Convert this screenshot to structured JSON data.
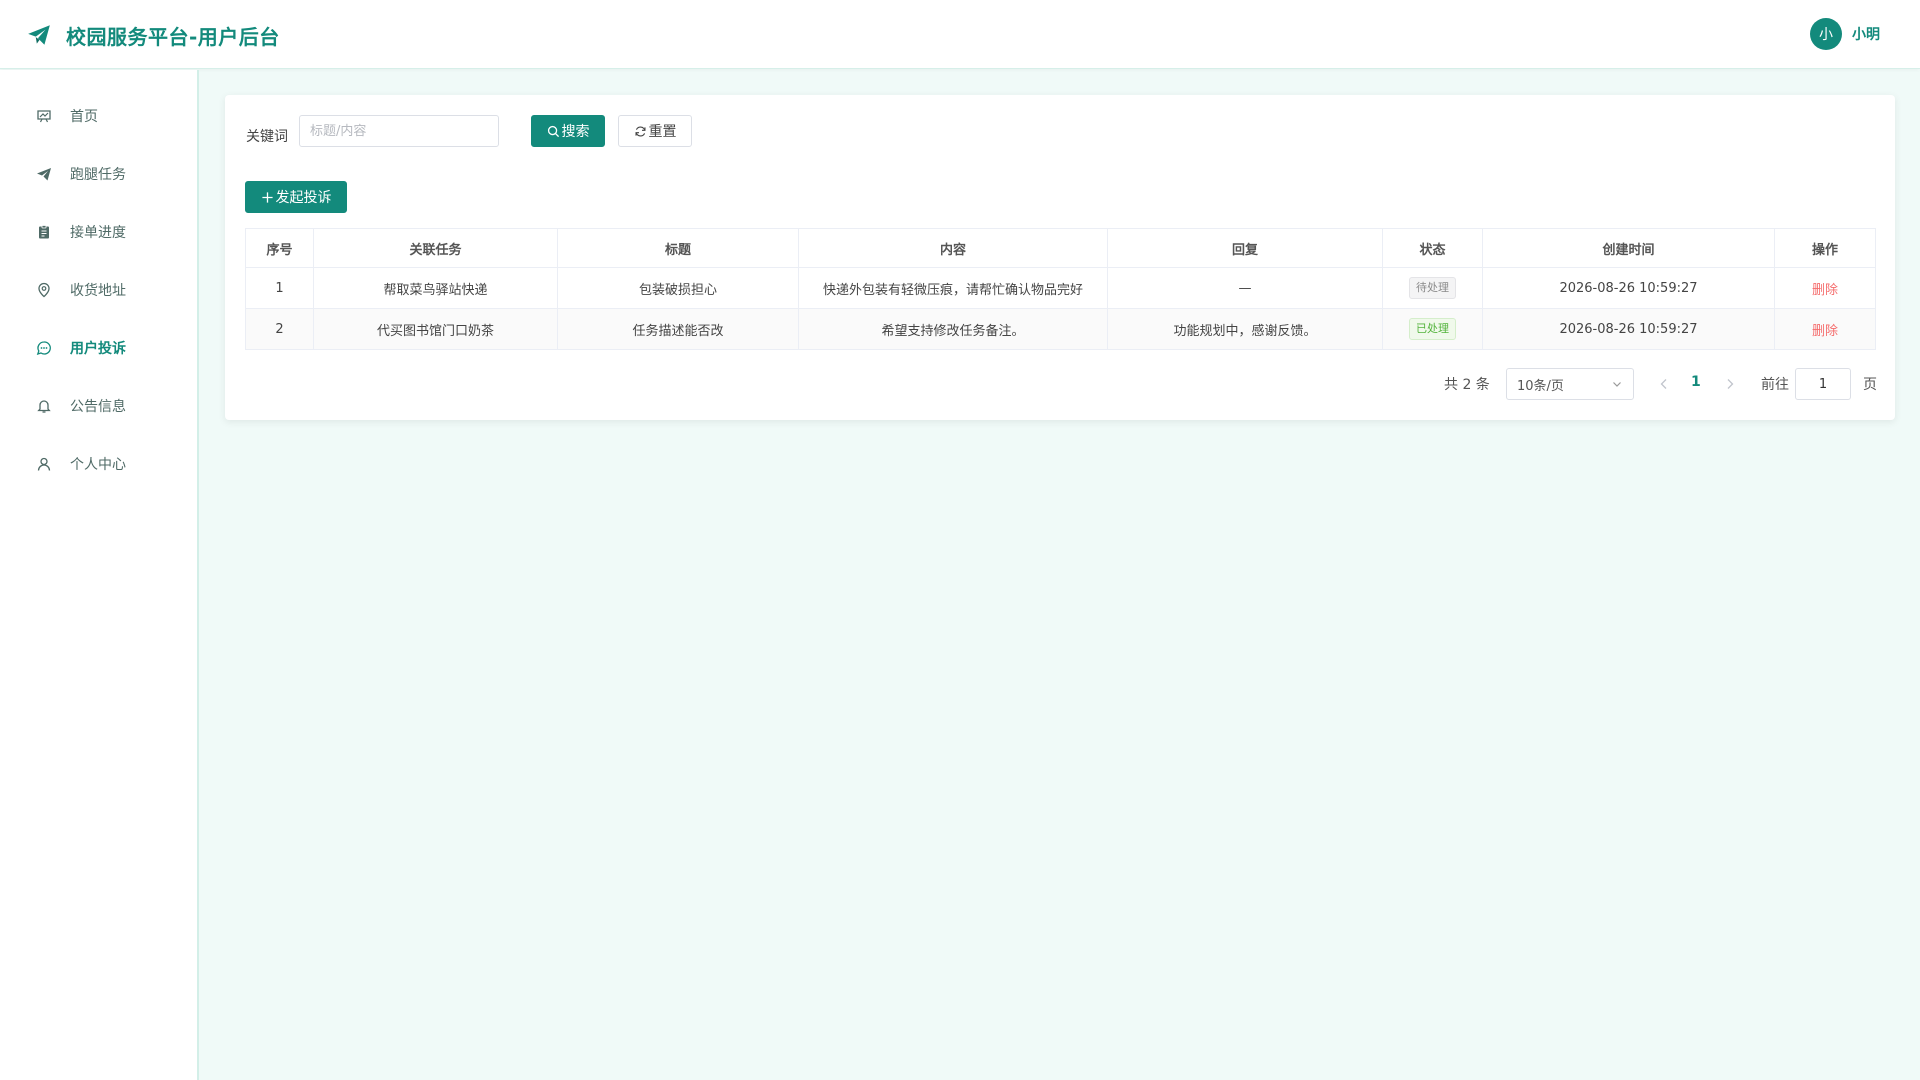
{
  "header": {
    "title": "校园服务平台-用户后台",
    "avatar_text": "小",
    "username": "小明"
  },
  "sidebar": {
    "items": [
      {
        "label": "首页",
        "icon": "presentation-board-icon"
      },
      {
        "label": "跑腿任务",
        "icon": "paper-plane-icon"
      },
      {
        "label": "接单进度",
        "icon": "clipboard-icon"
      },
      {
        "label": "收货地址",
        "icon": "map-pin-icon"
      },
      {
        "label": "用户投诉",
        "icon": "chat-bubble-icon",
        "active": true
      },
      {
        "label": "公告信息",
        "icon": "bell-icon"
      },
      {
        "label": "个人中心",
        "icon": "user-icon"
      }
    ]
  },
  "filter": {
    "keyword_label": "关键词",
    "keyword_placeholder": "标题/内容",
    "keyword_value": "",
    "search_label": "搜索",
    "reset_label": "重置"
  },
  "actions": {
    "add_label": "发起投诉"
  },
  "table": {
    "columns": [
      "序号",
      "关联任务",
      "标题",
      "内容",
      "回复",
      "状态",
      "创建时间",
      "操作"
    ],
    "rows": [
      {
        "index": "1",
        "task": "帮取菜鸟驿站快递",
        "title": "包装破损担心",
        "content": "快递外包装有轻微压痕，请帮忙确认物品完好",
        "reply": "—",
        "status": "待处理",
        "created": "2026-08-26 10:59:27",
        "action": "删除"
      },
      {
        "index": "2",
        "task": "代买图书馆门口奶茶",
        "title": "任务描述能否改",
        "content": "希望支持修改任务备注。",
        "reply": "功能规划中，感谢反馈。",
        "status": "已处理",
        "created": "2026-08-26 10:59:27",
        "action": "删除"
      }
    ]
  },
  "pagination": {
    "total_text": "共 2 条",
    "page_size": "10条/页",
    "current_page": "1",
    "goto_label": "前往",
    "goto_value": "1",
    "goto_suffix": "页"
  },
  "colors": {
    "primary": "#138a7c",
    "background": "#f0faf8",
    "danger": "#f56c6c",
    "success": "#53b33c"
  }
}
